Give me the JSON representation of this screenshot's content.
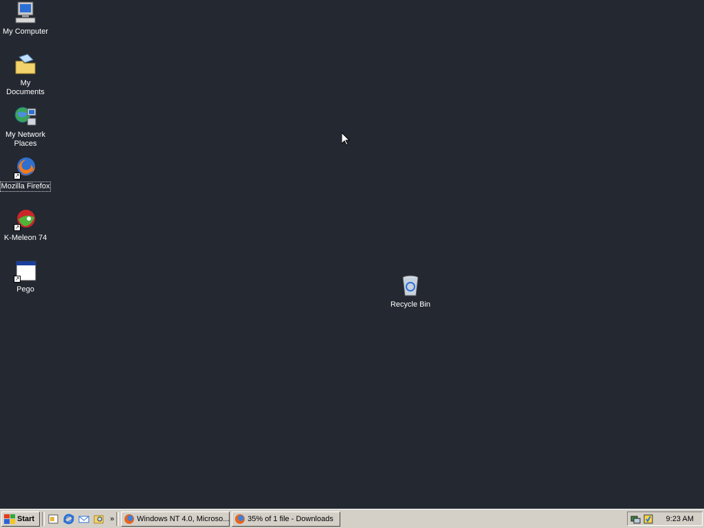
{
  "desktop": {
    "icons": [
      {
        "label": "My Computer"
      },
      {
        "label": "My Documents"
      },
      {
        "label": "My Network Places"
      },
      {
        "label": "Mozilla Firefox"
      },
      {
        "label": "K-Meleon 74"
      },
      {
        "label": "Pego"
      },
      {
        "label": "Recycle Bin"
      }
    ]
  },
  "taskbar": {
    "start_label": "Start",
    "quick_launch": [
      "desktop-icon",
      "internet-explorer-icon",
      "outlook-express-icon",
      "search-icon"
    ],
    "overflow_label": "»",
    "buttons": [
      {
        "label": "Windows NT 4.0, Microso..."
      },
      {
        "label": "35% of 1 file - Downloads"
      }
    ],
    "clock": "9:23 AM"
  },
  "colors": {
    "desktop_bg": "#232831",
    "taskbar_bg": "#d4d0c8"
  }
}
